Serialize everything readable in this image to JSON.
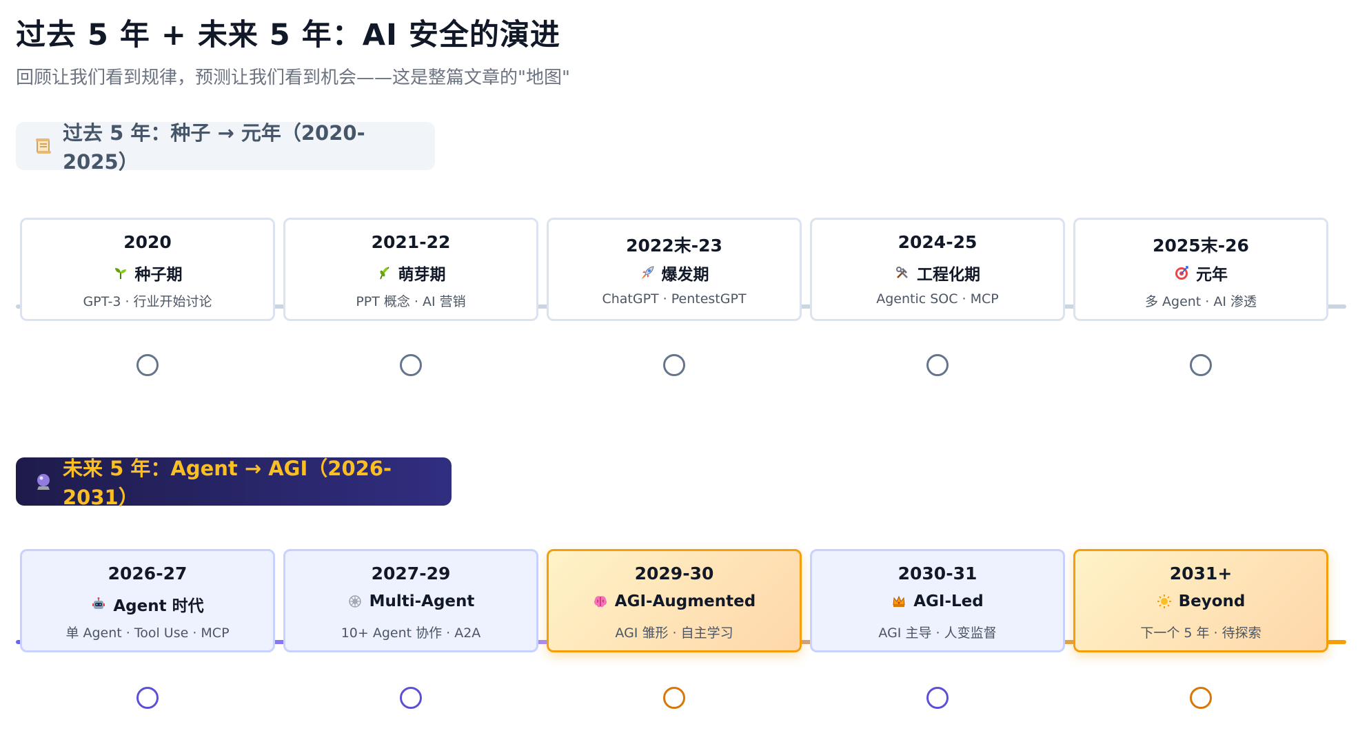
{
  "title": "过去 5 年 + 未来 5 年：AI 安全的演进",
  "subtitle": "回顾让我们看到规律，预测让我们看到机会——这是整篇文章的\"地图\"",
  "past": {
    "header": "过去 5 年：种子 → 元年（2020-2025）",
    "header_icon": "scroll-icon",
    "items": [
      {
        "year": "2020",
        "stage": "种子期",
        "icon": "seedling-icon",
        "desc": "GPT-3 · 行业开始讨论"
      },
      {
        "year": "2021-22",
        "stage": "萌芽期",
        "icon": "herb-icon",
        "desc": "PPT 概念 · AI 营销"
      },
      {
        "year": "2022末-23",
        "stage": "爆发期",
        "icon": "rocket-icon",
        "desc": "ChatGPT · PentestGPT"
      },
      {
        "year": "2024-25",
        "stage": "工程化期",
        "icon": "tools-icon",
        "desc": "Agentic SOC · MCP"
      },
      {
        "year": "2025末-26",
        "stage": "元年",
        "icon": "target-icon",
        "desc": "多 Agent · AI 渗透"
      }
    ]
  },
  "future": {
    "header": "未来 5 年：Agent → AGI（2026-2031）",
    "header_icon": "crystal-ball-icon",
    "items": [
      {
        "year": "2026-27",
        "stage": "Agent 时代",
        "icon": "robot-icon",
        "desc": "单 Agent · Tool Use · MCP",
        "highlight": false
      },
      {
        "year": "2027-29",
        "stage": "Multi-Agent",
        "icon": "network-icon",
        "desc": "10+ Agent 协作 · A2A",
        "highlight": false
      },
      {
        "year": "2029-30",
        "stage": "AGI-Augmented",
        "icon": "brain-icon",
        "desc": "AGI 雏形 · 自主学习",
        "highlight": true
      },
      {
        "year": "2030-31",
        "stage": "AGI-Led",
        "icon": "crown-icon",
        "desc": "AGI 主导 · 人变监督",
        "highlight": false
      },
      {
        "year": "2031+",
        "stage": "Beyond",
        "icon": "sparkle-sun-icon",
        "desc": "下一个 5 年 · 待探索",
        "highlight": true
      }
    ]
  },
  "colors": {
    "past_track": "#cbd5e1",
    "future_accent": "#6366f1",
    "highlight": "#f59e0b",
    "future_header_text": "#fbbf24"
  }
}
